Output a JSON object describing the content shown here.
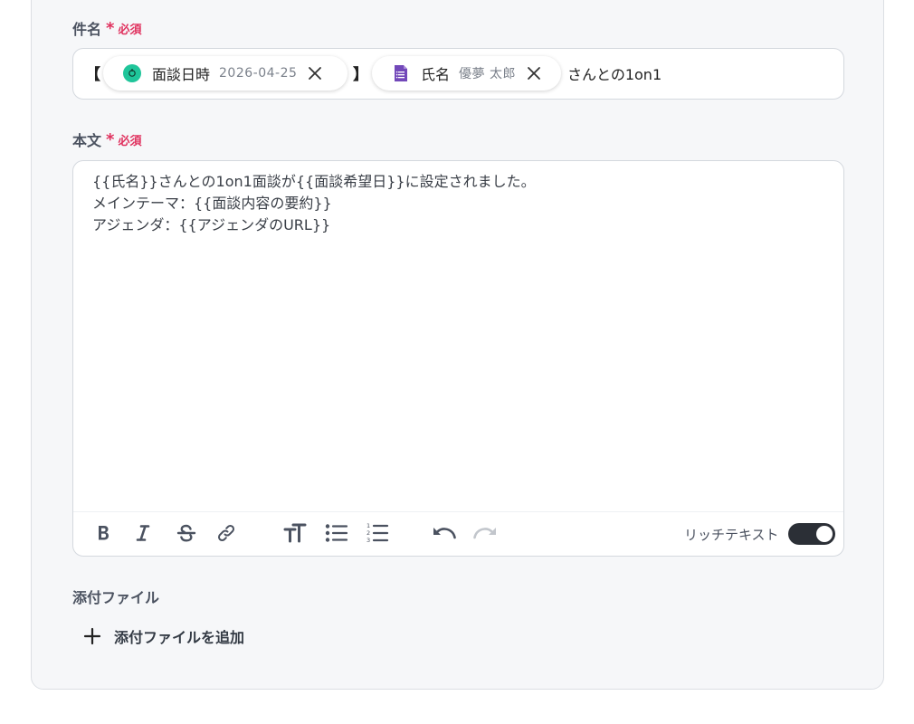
{
  "subject": {
    "label": "件名",
    "required_mark": "*",
    "required_text": "必須",
    "open_bracket": "【",
    "close_bracket": "】",
    "chips": [
      {
        "label": "面談日時",
        "value": "2026-04-25",
        "icon": "app-green-icon",
        "color": "#1fc59a"
      },
      {
        "label": "氏名",
        "value": "優夢 太郎",
        "icon": "google-forms-icon",
        "color": "#7248b9"
      }
    ],
    "tail": "さんとの1on1"
  },
  "body": {
    "label": "本文",
    "required_mark": "*",
    "required_text": "必須",
    "lines": [
      "{{氏名}}さんとの1on1面談が{{面談希望日}}に設定されました。",
      "メインテーマ：{{面談内容の要約}}",
      "アジェンダ：{{アジェンダのURL}}"
    ],
    "toolbar": {
      "buttons": [
        "bold-icon",
        "italic-icon",
        "strikethrough-icon",
        "link-icon",
        "text-size-icon",
        "bullet-list-icon",
        "numbered-list-icon",
        "undo-icon",
        "redo-icon"
      ],
      "rich_text_label": "リッチテキスト",
      "rich_text_enabled": true
    }
  },
  "attachments": {
    "label": "添付ファイル",
    "add_label": "添付ファイルを追加"
  }
}
